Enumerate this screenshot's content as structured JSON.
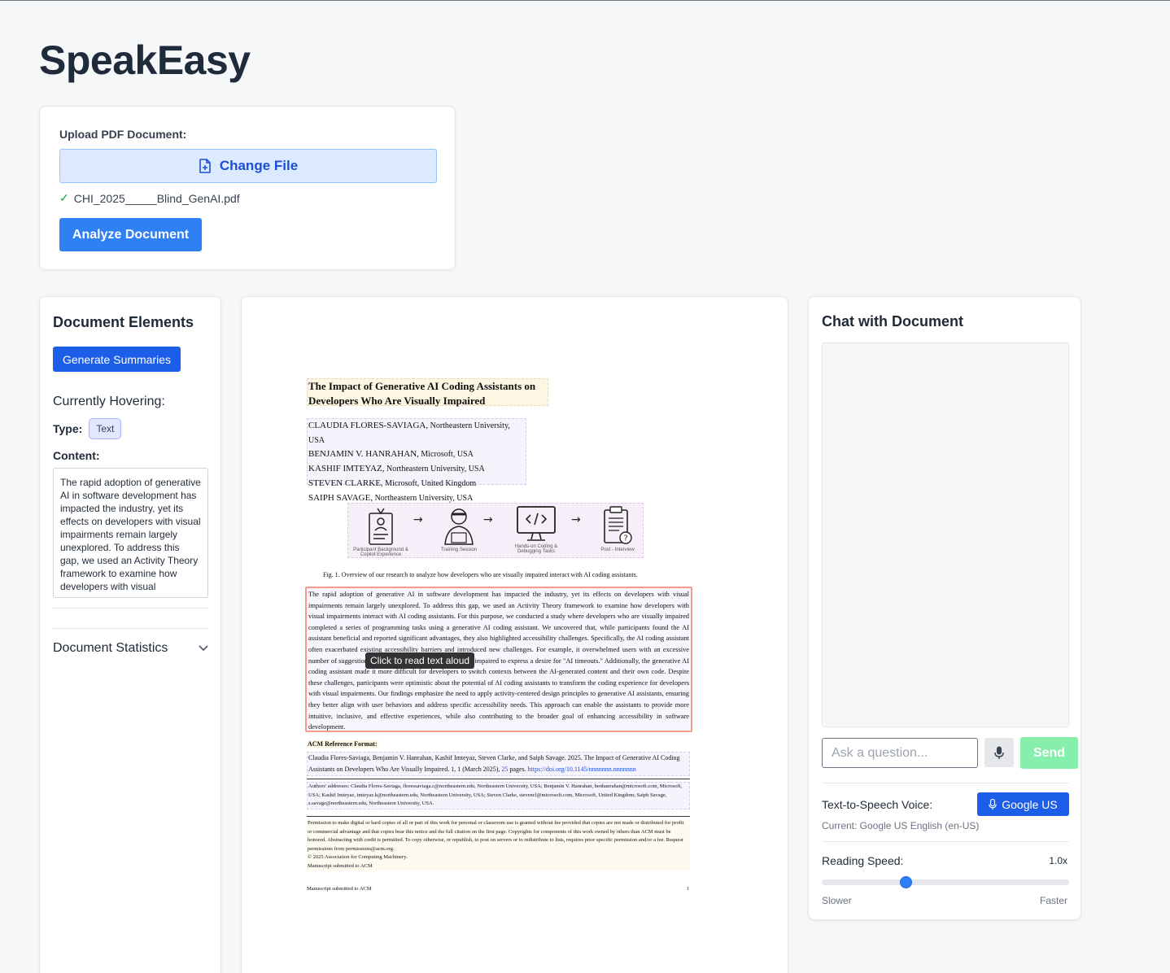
{
  "app": {
    "title": "SpeakEasy"
  },
  "upload": {
    "label": "Upload PDF Document:",
    "change_file": "Change File",
    "file_name": "CHI_2025_____Blind_GenAI.pdf",
    "analyze": "Analyze Document"
  },
  "elements": {
    "heading": "Document Elements",
    "generate": "Generate Summaries",
    "hovering": "Currently Hovering:",
    "type_label": "Type:",
    "type_value": "Text",
    "content_label": "Content:",
    "content": "The rapid adoption of generative AI in software development has impacted the industry, yet its effects on developers with visual impairments remain largely unexplored. To address this gap, we used an Activity Theory framework to examine how developers with visual",
    "stats": "Document Statistics"
  },
  "pdf": {
    "title": "The Impact of Generative AI Coding Assistants on Developers Who Are Visually Impaired",
    "authors": [
      {
        "name": "CLAUDIA FLORES-SAVIAGA,",
        "affil": "Northeastern University, USA"
      },
      {
        "name": "BENJAMIN V. HANRAHAN,",
        "affil": "Microsoft, USA"
      },
      {
        "name": "KASHIF IMTEYAZ,",
        "affil": "Northeastern University, USA"
      },
      {
        "name": "STEVEN CLARKE,",
        "affil": "Microsoft, United Kingdom"
      },
      {
        "name": "SAIPH SAVAGE,",
        "affil": "Northeastern University, USA"
      }
    ],
    "figure_steps": [
      {
        "label": "Participant Background & Copilot Experience",
        "icon": "id-badge-icon"
      },
      {
        "label": "Training Session",
        "icon": "developer-icon"
      },
      {
        "label": "Hands-on Coding & Debugging Tasks",
        "icon": "monitor-code-icon"
      },
      {
        "label": "Post - Interview",
        "icon": "clipboard-question-icon"
      }
    ],
    "fig_caption": "Fig. 1.  Overview of our research to analyze how developers who are visually impaired interact with AI coding assistants.",
    "abstract": "The rapid adoption of generative AI in software development has impacted the industry, yet its effects on developers with visual impairments remain largely unexplored. To address this gap, we used an Activity Theory framework to examine how developers with visual impairments interact with AI coding assistants. For this purpose, we conducted a study where developers who are visually impaired completed a series of programming tasks using a generative AI coding assistant. We uncovered that, while participants found the AI assistant beneficial and reported significant advantages, they also highlighted accessibility challenges. Specifically, the AI coding assistant often exacerbated existing accessibility barriers and introduced new challenges. For example, it overwhelmed users with an excessive number of suggestions, leading developers who are visually impaired to express a desire for \"AI timeouts.\" Additionally, the generative AI coding assistant made it more difficult for developers to switch contexts between the AI-generated content and their own code. Despite these challenges, participants were optimistic about the potential of AI coding assistants to transform the coding experience for developers with visual impairments. Our findings emphasize the need to apply activity-centered design principles to generative AI assistants, ensuring they better align with user behaviors and address specific accessibility needs. This approach can enable the assistants to provide more intuitive, inclusive, and effective experiences, while also contributing to the broader goal of enhancing accessibility in software development.",
    "tooltip": "Click to read text aloud",
    "ref_heading": "ACM Reference Format:",
    "ref_text": "Claudia Flores-Saviaga, Benjamin V. Hanrahan, Kashif Imteyaz, Steven Clarke, and Saiph Savage. 2025. The Impact of Generative AI Coding Assistants on Developers Who Are Visually Impaired.  1, 1 (March 2025),",
    "ref_pages_num": "25",
    "ref_pages_word": "pages.",
    "ref_link": "https://doi.org/10.1145/nnnnnnn.nnnnnnn",
    "addresses": "Authors' addresses: Claudia Flores-Saviaga, floressaviaga.c@northeastern.edu, Northeastern University, USA; Benjamin V. Hanrahan, benhanrahan@microsoft.com, Microsoft, USA; Kashif Imteyaz, imteyaz.k@northeastern.edu, Northeastern University, USA; Steven Clarke, stevencl@microsoft.com, Microsoft, United Kingdom; Saiph Savage, s.savage@northeastern.edu, Northeastern University, USA.",
    "permission": "Permission to make digital or hard copies of all or part of this work for personal or classroom use is granted without fee provided that copies are not made or distributed for profit or commercial advantage and that copies bear this notice and the full citation on the first page. Copyrights for components of this work owned by others than ACM must be honored. Abstracting with credit is permitted. To copy otherwise, or republish, to post on servers or to redistribute to lists, requires prior specific permission and/or a fee. Request permissions from permissions@acm.org.",
    "copyright": "© 2025 Association for Computing Machinery.",
    "manuscript": "Manuscript submitted to ACM",
    "footer_left": "Manuscript submitted to ACM",
    "page_number": "1"
  },
  "chat": {
    "heading": "Chat with Document",
    "placeholder": "Ask a question...",
    "send": "Send",
    "tts_label": "Text-to-Speech Voice:",
    "voice_button": "Google US",
    "current_voice": "Current: Google US English (en-US)",
    "speed_label": "Reading Speed:",
    "speed_value": "1.0x",
    "speed_fraction": 0.34,
    "slower": "Slower",
    "faster": "Faster"
  },
  "colors": {
    "accent": "#2f80f3",
    "send_disabled": "#86efac",
    "highlight_border": "#f39c8b"
  }
}
